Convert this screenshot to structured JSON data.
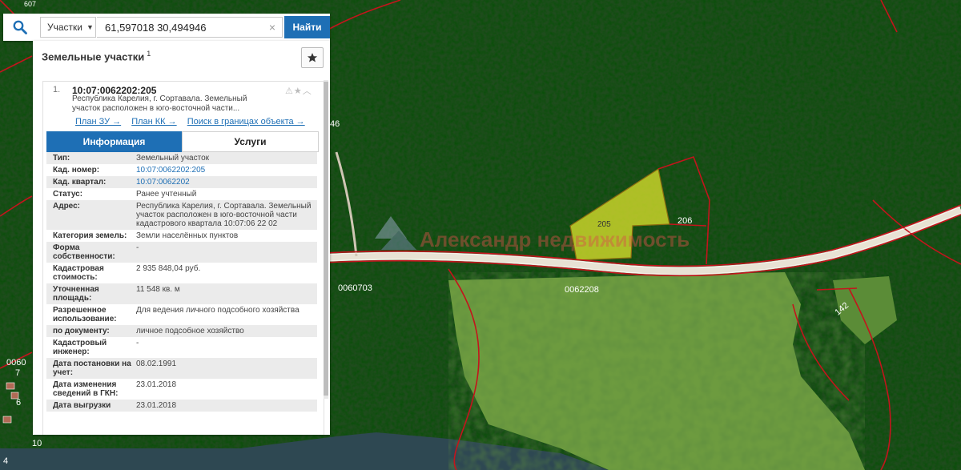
{
  "search": {
    "category_label": "Участки",
    "query_value": "61,597018 30,494946",
    "clear_symbol": "×",
    "submit_label": "Найти"
  },
  "panel": {
    "title": "Земельные участки",
    "title_count": "1"
  },
  "result": {
    "number": "1.",
    "cadastral_id": "10:07:0062202:205",
    "description": "Республика Карелия, г. Сортавала. Земельный участок расположен в юго-восточной части...",
    "links": [
      "План ЗУ →",
      "План КК →",
      "Поиск в границах объекта →"
    ]
  },
  "tabs": {
    "info_label": "Информация",
    "services_label": "Услуги"
  },
  "fields": [
    {
      "key": "Тип:",
      "value": "Земельный участок"
    },
    {
      "key": "Кад. номер:",
      "value": "10:07:0062202:205"
    },
    {
      "key": "Кад. квартал:",
      "value": "10:07:0062202"
    },
    {
      "key": "Статус:",
      "value": "Ранее учтенный"
    },
    {
      "key": "Адрес:",
      "value": "Республика Карелия, г. Сортавала. Земельный участок расположен в юго-восточной части кадастрового квартала 10:07:06 22 02"
    },
    {
      "key": "Категория земель:",
      "value": "Земли населённых пунктов"
    },
    {
      "key": "Форма собственности:",
      "value": "-"
    },
    {
      "key": "Кадастровая стоимость:",
      "value": "2 935 848,04 руб."
    },
    {
      "key": "Уточненная площадь:",
      "value": "11 548 кв. м"
    },
    {
      "key": "Разрешенное использование:",
      "value": "Для ведения личного подсобного хозяйства"
    },
    {
      "key": "по документу:",
      "value": "личное подсобное хозяйство"
    },
    {
      "key": "Кадастровый инженер:",
      "value": "-"
    },
    {
      "key": "Дата постановки на учет:",
      "value": "08.02.1991"
    },
    {
      "key": "Дата изменения сведений в ГКН:",
      "value": "23.01.2018"
    },
    {
      "key": "Дата выгрузки",
      "value": "23.01.2018"
    }
  ],
  "map": {
    "labels": {
      "parcel_205": "205",
      "parcel_206": "206",
      "quarter_60703": "0060703",
      "quarter_62208": "0062208",
      "parcel_142": "142",
      "quarter_0607": "0060",
      "parcel_10": "10",
      "parcel_7": "7",
      "parcel_6": "6",
      "parcel_4": "4",
      "parcel_46": "46",
      "parcel_607": "607"
    },
    "watermark": "Александр недвижимость",
    "colors": {
      "forest": "#1d4a1c",
      "field": "#6a9a3e",
      "road": "#e9e3d6",
      "boundary": "#c4141c",
      "highlight": "#dde22a",
      "water": "#2f4a55"
    }
  }
}
